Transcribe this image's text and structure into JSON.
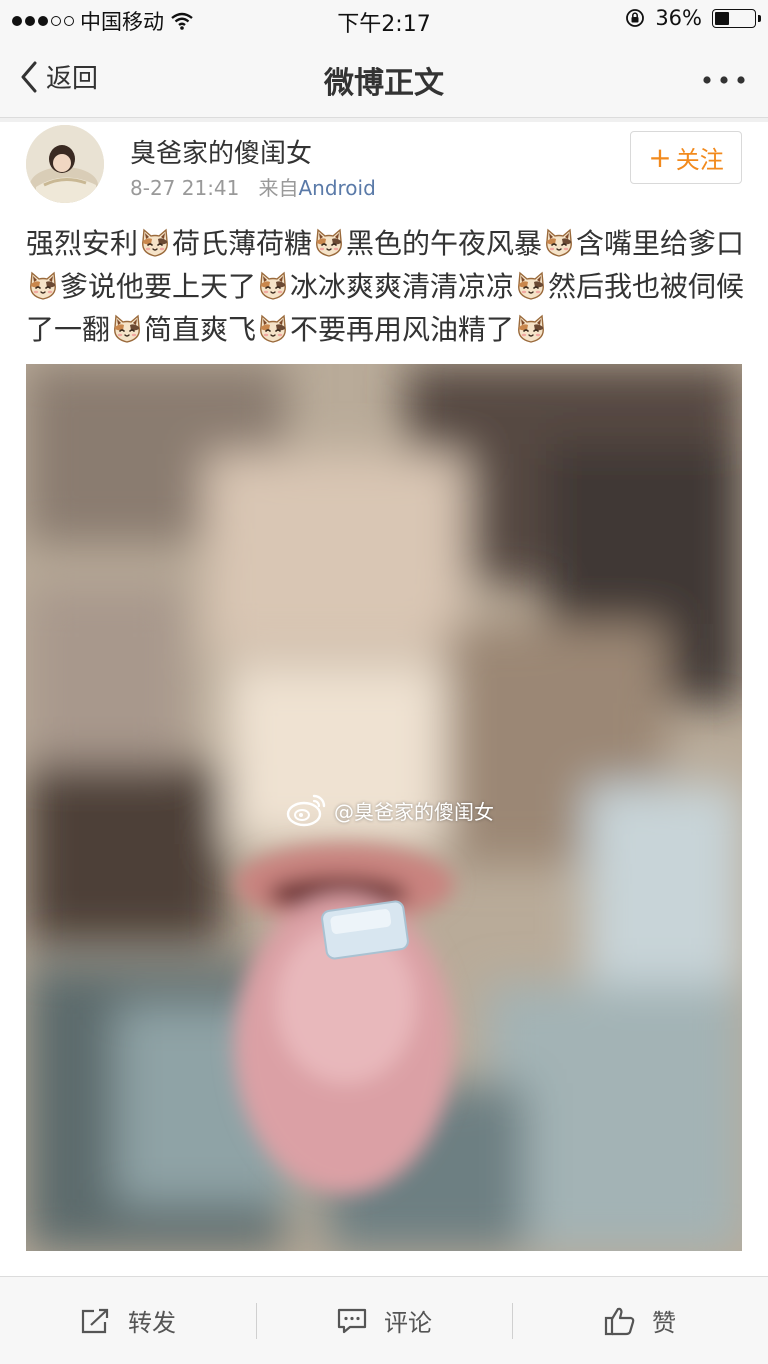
{
  "status_bar": {
    "carrier": "中国移动",
    "time": "下午2:17",
    "battery_percent": "36%",
    "battery_level": 0.36,
    "signal_bars_filled": 3,
    "signal_bars_total": 5,
    "icons": [
      "wifi-icon",
      "orientation-lock-icon",
      "battery-icon"
    ]
  },
  "nav": {
    "back_label": "返回",
    "title": "微博正文",
    "more_icon": "more-dots-icon"
  },
  "post": {
    "author": "臭爸家的傻闺女",
    "date": "8-27 21:41",
    "source_prefix": "来自",
    "source": "Android",
    "follow_label": "关注",
    "text_segments": [
      "强烈安利",
      "荷氏薄荷糖",
      "黑色的午夜风暴",
      "含嘴里给爹口",
      "爹说他要上天了",
      "冰冰爽爽清清凉凉",
      "然后我也被伺候了一翻",
      "简直爽飞",
      "不要再用风油精了"
    ],
    "emoji_icon": "cat-face-emoji-icon",
    "image_watermark": "@臭爸家的傻闺女"
  },
  "toolbar": {
    "repost_label": "转发",
    "comment_label": "评论",
    "like_label": "赞"
  },
  "colors": {
    "accent_orange": "#f28a1d",
    "link_blue": "#5a7aa8",
    "bar_bg": "#f7f7f7"
  }
}
